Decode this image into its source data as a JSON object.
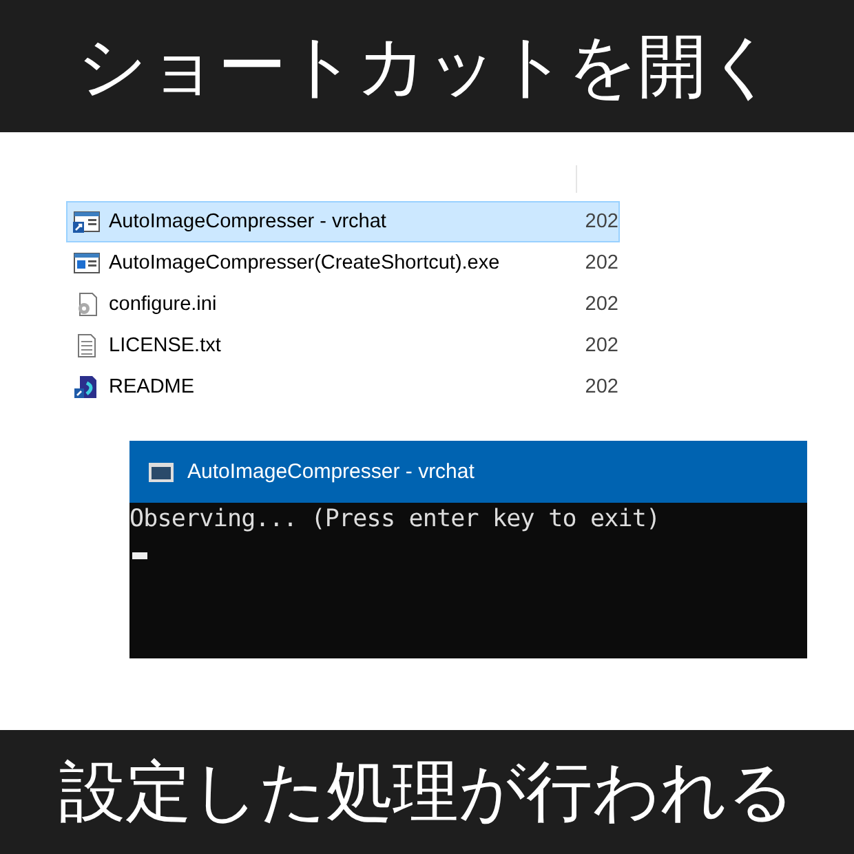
{
  "top_caption": "ショートカットを開く",
  "files": [
    {
      "kind": "shortcut",
      "name": "AutoImageCompresser - vrchat",
      "date": "202",
      "selected": true
    },
    {
      "kind": "exe",
      "name": "AutoImageCompresser(CreateShortcut).exe",
      "date": "202",
      "selected": false
    },
    {
      "kind": "config",
      "name": "configure.ini",
      "date": "202",
      "selected": false
    },
    {
      "kind": "text",
      "name": "LICENSE.txt",
      "date": "202",
      "selected": false
    },
    {
      "kind": "readme",
      "name": "README",
      "date": "202",
      "selected": false
    }
  ],
  "console": {
    "title": "AutoImageCompresser - vrchat",
    "output": "Observing... (Press enter key to exit)"
  },
  "bottom_caption": "設定した処理が行われる"
}
